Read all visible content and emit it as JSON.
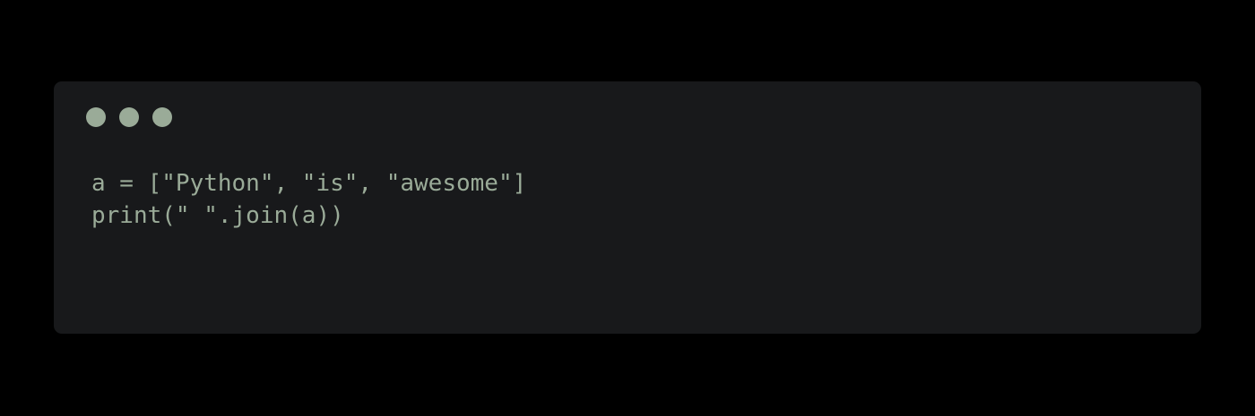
{
  "theme": {
    "page_background": "#000000",
    "window_background": "#18191b",
    "text_color": "#9aab98",
    "dot_colors": [
      "#9aab98",
      "#9aab98",
      "#9aab98"
    ]
  },
  "window": {
    "controls": [
      {
        "icon": "window-control-dot"
      },
      {
        "icon": "window-control-dot"
      },
      {
        "icon": "window-control-dot"
      }
    ]
  },
  "code": {
    "language": "python",
    "lines": [
      "a = [\"Python\", \"is\", \"awesome\"]",
      "print(\" \".join(a))"
    ]
  }
}
